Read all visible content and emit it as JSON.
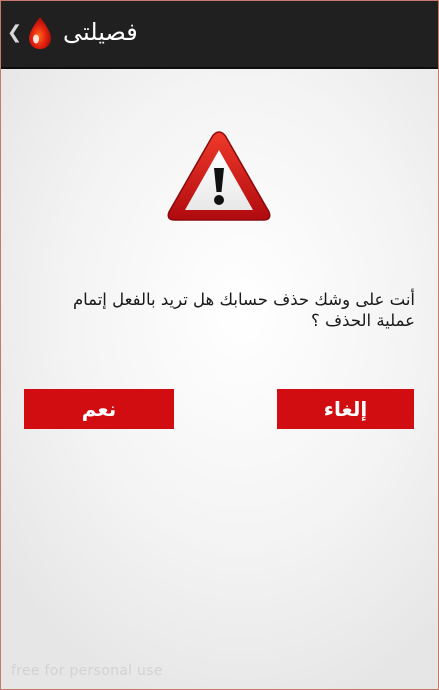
{
  "app_bar": {
    "title": "فصيلتى",
    "back_icon": "chevron-left-icon",
    "logo_icon": "blood-drop-icon"
  },
  "dialog": {
    "icon": "warning-triangle-icon",
    "message_line1": "أنت على وشك حذف حسابك هل تريد بالفعل إتمام",
    "message_line2": "عملية الحذف ؟",
    "confirm_label": "نعم",
    "cancel_label": "إلغاء"
  },
  "watermark": "free for personal use",
  "colors": {
    "app_bar_bg": "#202020",
    "button_red": "#d10d12",
    "warning_red": "#d8141b"
  }
}
